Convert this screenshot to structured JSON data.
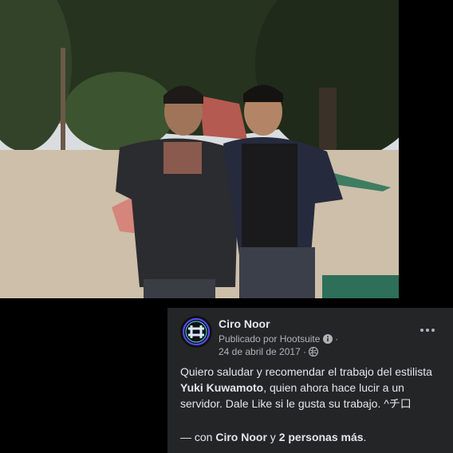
{
  "post": {
    "author": "Ciro Noor",
    "published_by": "Publicado por Hootsuite",
    "separator": "·",
    "date": "24 de abril de 2017",
    "text_before": "Quiero saludar y recomendar el trabajo del estilista ",
    "text_mention": "Yuki Kuwamoto",
    "text_after": ", quien ahora hace lucir a un servidor. Dale Like si le gusta su trabajo. ^チ口",
    "with_prefix": "— con ",
    "with_name": "Ciro Noor",
    "with_conj": " y ",
    "with_others": "2 personas más",
    "with_end": "."
  },
  "icons": {
    "avatar_logo": "Ciro Noor avatar (circular neon logo)",
    "info": "info-icon",
    "globe": "globe-icon",
    "more": "more-options-icon"
  },
  "colors": {
    "card_bg": "#242526",
    "text_primary": "#e4e6eb",
    "text_secondary": "#b0b3b8",
    "page_bg": "#000000"
  }
}
